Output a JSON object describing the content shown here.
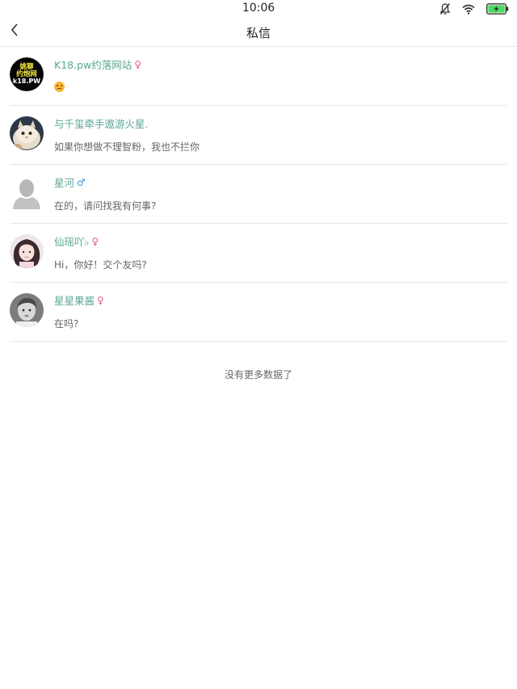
{
  "status_bar": {
    "time": "10:06",
    "icons": [
      "mute-icon",
      "wifi-icon",
      "battery-charging-icon"
    ]
  },
  "nav": {
    "title": "私信",
    "back_icon": "chevron-left-icon"
  },
  "messages": [
    {
      "name": "K18.pw约落网站",
      "gender": "♀",
      "gender_type": "female",
      "preview_emoji": "sad-face-emoji",
      "avatar": "logo-avatar",
      "avatar_text": [
        "姚聊",
        "约炮网",
        "k18.PW"
      ]
    },
    {
      "name": "与千玺牵手遨游火星.",
      "preview": "如果你想做不理智粉，我也不拦你",
      "avatar": "cat-photo-avatar"
    },
    {
      "name": "星河",
      "gender": "♂",
      "gender_type": "male",
      "preview": "在的，请问找我有何事?",
      "avatar": "default-silhouette-avatar"
    },
    {
      "name": "仙瑶吖♭",
      "gender": "♀",
      "gender_type": "female",
      "preview": "Hi，你好！交个友吗?",
      "avatar": "girl-photo-avatar"
    },
    {
      "name": "星星果酱",
      "gender": "♀",
      "gender_type": "female",
      "preview": "在吗?",
      "avatar": "child-photo-avatar"
    }
  ],
  "footer": {
    "no_more": "没有更多数据了"
  },
  "colors": {
    "name_text": "#5aa694",
    "female": "#e05c86",
    "male": "#3a8fd6",
    "divider": "#e6e6e6",
    "battery_fill": "#4cd964"
  }
}
